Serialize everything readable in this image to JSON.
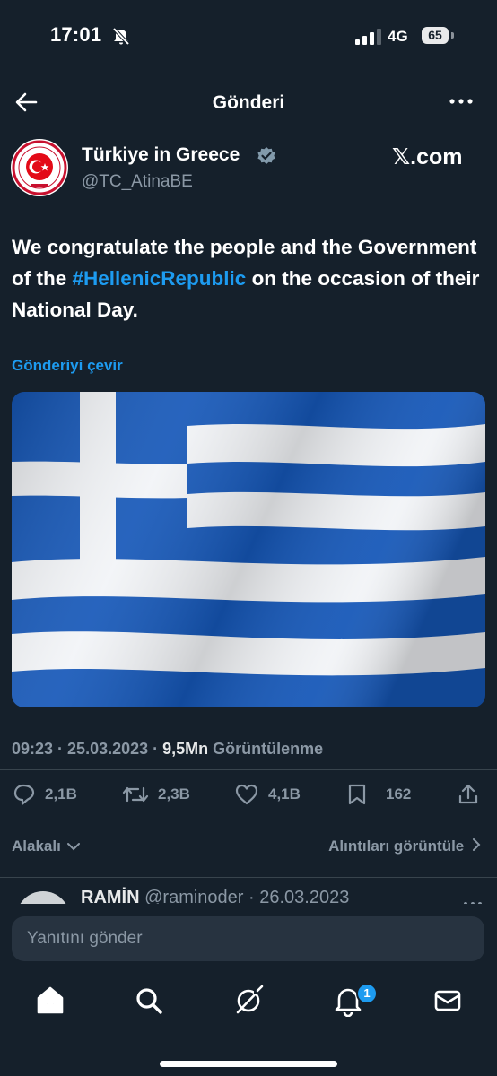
{
  "status_bar": {
    "time": "17:01",
    "network": "4G",
    "battery": "65"
  },
  "header": {
    "title": "Gönderi"
  },
  "author": {
    "name": "Türkiye in Greece",
    "handle": "@TC_AtinaBE",
    "source": "𝕏.com"
  },
  "tweet": {
    "text_before": "We congratulate the people and the Government of the ",
    "hashtag": "#HellenicRepublic",
    "text_after": " on the occasion of their National Day.",
    "translate": "Gönderiyi çevir"
  },
  "meta": {
    "time": "09:23",
    "sep1": " · ",
    "date": "25.03.2023",
    "sep2": " · ",
    "views": "9,5Mn",
    "views_label": " Görüntülenme"
  },
  "actions": {
    "replies": "2,1B",
    "retweets": "2,3B",
    "likes": "4,1B",
    "bookmarks": "162"
  },
  "filters": {
    "related": "Alakalı",
    "quotes": "Alıntıları görüntüle"
  },
  "reply_peek": {
    "name": "RAMİN",
    "handle": "@raminoder",
    "date": "· 26.03.2023"
  },
  "composer": {
    "placeholder": "Yanıtını gönder"
  },
  "nav": {
    "notification_count": "1"
  },
  "colors": {
    "background": "#15202b",
    "accent": "#1d9bf0",
    "muted": "#8b98a5",
    "flag_blue": "#0d5eaf"
  }
}
